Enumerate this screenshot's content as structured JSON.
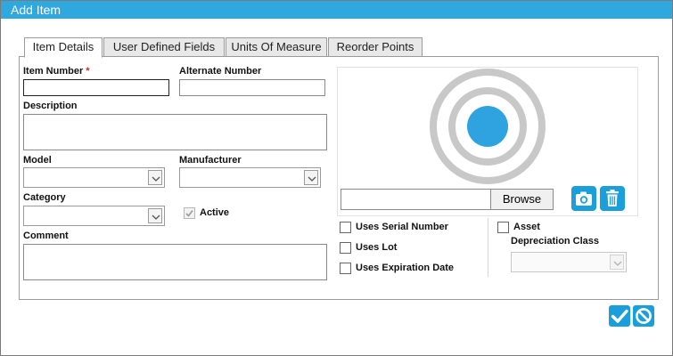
{
  "window": {
    "title": "Add Item"
  },
  "tabs": [
    {
      "label": "Item Details",
      "active": true
    },
    {
      "label": "User Defined Fields",
      "active": false
    },
    {
      "label": "Units Of Measure",
      "active": false
    },
    {
      "label": "Reorder Points",
      "active": false
    }
  ],
  "form": {
    "item_number": {
      "label": "Item Number",
      "required_mark": "*",
      "value": ""
    },
    "alternate_number": {
      "label": "Alternate Number",
      "value": ""
    },
    "description": {
      "label": "Description",
      "value": ""
    },
    "model": {
      "label": "Model",
      "value": ""
    },
    "manufacturer": {
      "label": "Manufacturer",
      "value": ""
    },
    "category": {
      "label": "Category",
      "value": ""
    },
    "active": {
      "label": "Active",
      "checked": true,
      "disabled": true
    },
    "comment": {
      "label": "Comment",
      "value": ""
    }
  },
  "image": {
    "placeholder_icon": "target-placeholder-icon",
    "file_path": "",
    "browse_label": "Browse",
    "camera_icon": "camera-icon",
    "delete_icon": "trash-icon"
  },
  "options": {
    "uses_serial_number": {
      "label": "Uses Serial Number",
      "checked": false
    },
    "uses_lot": {
      "label": "Uses Lot",
      "checked": false
    },
    "uses_expiration_date": {
      "label": "Uses Expiration Date",
      "checked": false
    },
    "asset": {
      "label": "Asset",
      "checked": false
    },
    "depreciation_class": {
      "label": "Depreciation Class",
      "value": "",
      "disabled": true
    }
  },
  "footer": {
    "ok_icon": "checkmark-icon",
    "cancel_icon": "cancel-icon"
  },
  "colors": {
    "accent": "#2ea8df",
    "button_blue": "#1b9fdb",
    "required": "#d8262c"
  }
}
